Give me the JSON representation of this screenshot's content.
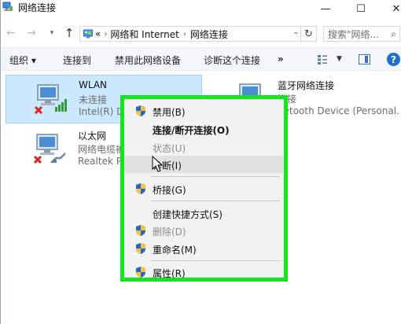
{
  "window": {
    "title": "网络连接",
    "controls": {
      "minimize": "—",
      "maximize": "☐",
      "close": "✕"
    }
  },
  "address_bar": {
    "overflow": "«",
    "breadcrumbs": [
      "网络和 Internet",
      "网络连接"
    ],
    "separator": "›",
    "search_placeholder": "搜索\"网络..."
  },
  "toolbar": {
    "organize": "组织 ▾",
    "connect": "连接到",
    "disable": "禁用此网络设备",
    "diagnose": "诊断这个连接",
    "more": "»",
    "help": "?"
  },
  "adapters": [
    {
      "name": "WLAN",
      "status": "未连接",
      "device": "Intel(R) D",
      "selected": true
    },
    {
      "name": "以太网",
      "status": "网络电缆被",
      "device": "Realtek P"
    },
    {
      "name": "蓝牙网络连接",
      "status": "连接",
      "device": "uetooth Device (Personal..."
    }
  ],
  "context_menu": {
    "items": [
      {
        "label": "禁用(B)",
        "shield": true
      },
      {
        "label": "连接/断开连接(O)",
        "bold": true
      },
      {
        "label": "状态(U)",
        "disabled": true
      },
      {
        "label": "诊断(I)",
        "hover": true
      },
      {
        "label": "桥接(G)",
        "shield": true
      },
      {
        "label": "创建快捷方式(S)"
      },
      {
        "label": "删除(D)",
        "shield": true,
        "disabled": true
      },
      {
        "label": "重命名(M)",
        "shield": true
      },
      {
        "label": "属性(R)",
        "shield": true
      }
    ],
    "highlight_color": "#11e71e"
  },
  "colors": {
    "selection_bg": "#cce8ff",
    "selection_border": "#99d1ff",
    "help_blue": "#1f6fd0"
  }
}
